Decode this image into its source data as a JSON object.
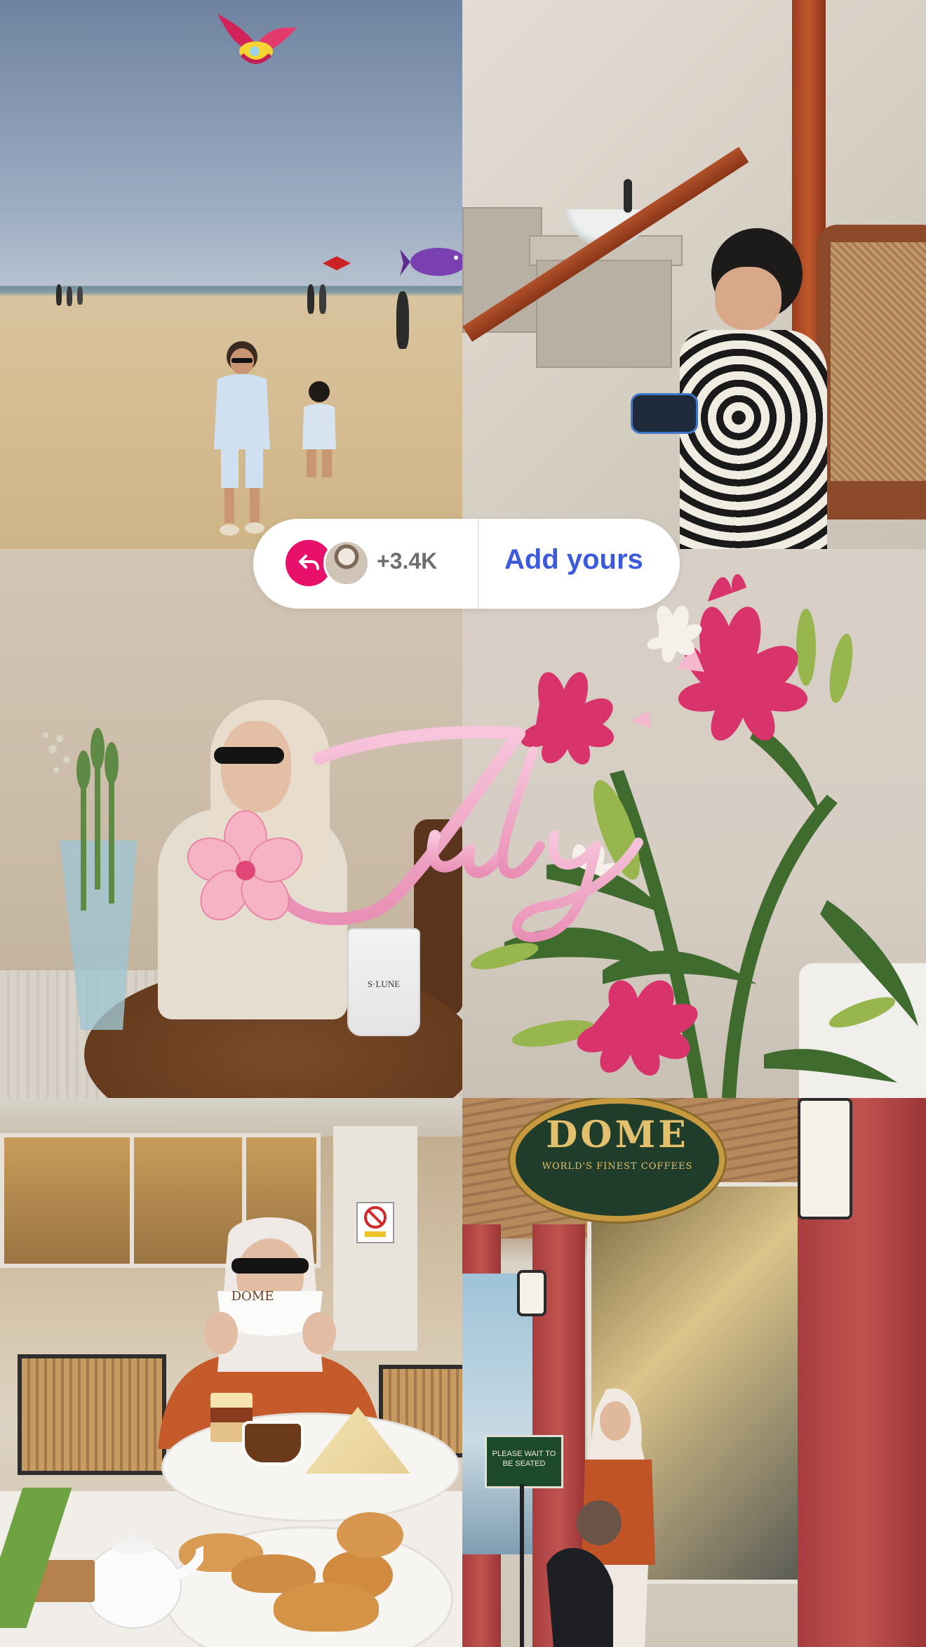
{
  "collage": {
    "tiles": [
      {
        "id": "beach",
        "caption": ""
      },
      {
        "id": "toddler-window",
        "caption": ""
      },
      {
        "id": "woman-flowers",
        "caption": ""
      },
      {
        "id": "lilies",
        "caption": ""
      },
      {
        "id": "afternoon-tea",
        "caption": ""
      },
      {
        "id": "dome-cafe",
        "caption": ""
      }
    ]
  },
  "sticker": {
    "participants_count": "+3.4K",
    "action_label": "Add yours",
    "icon": "reply-arrow-icon",
    "accent_color": "#e9106c",
    "action_color": "#3b5bdb"
  },
  "overlay": {
    "script_word": "July",
    "script_color": "#f0a9c8"
  },
  "cafe": {
    "cup_text": "DOME",
    "sign_title": "DOME",
    "sign_ribbon": "WORLD'S FINEST COFFEES",
    "seat_sign": "PLEASE WAIT TO BE SEATED",
    "cup_label": "S·LUNE"
  }
}
